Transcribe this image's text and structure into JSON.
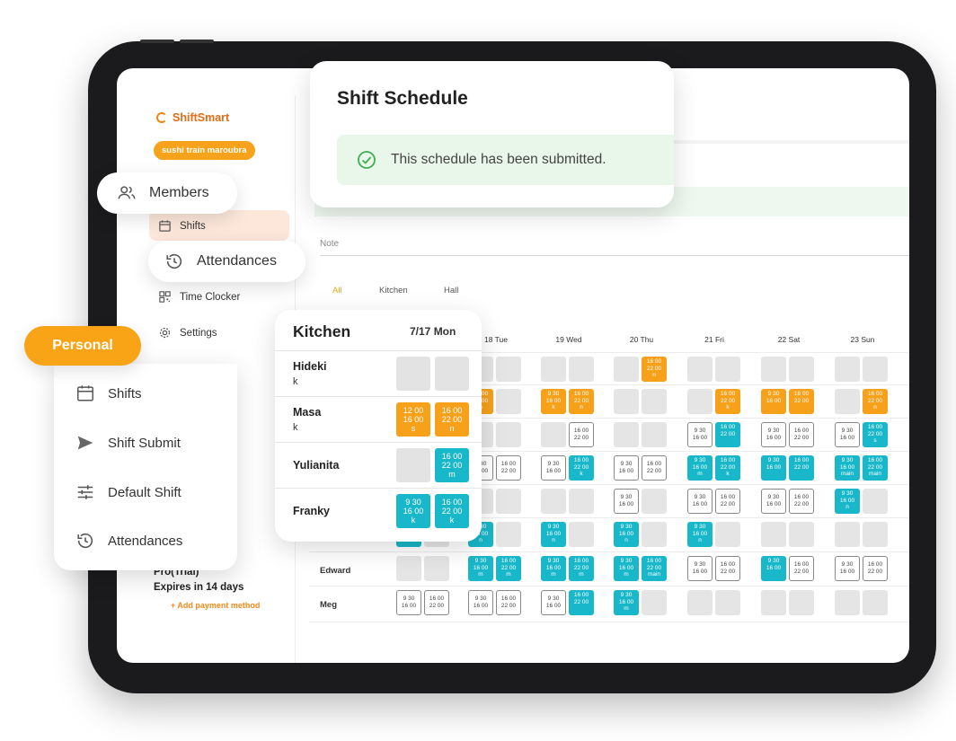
{
  "brand": {
    "name": "ShiftSmart",
    "store": "sushi train maroubra"
  },
  "sidebar": {
    "items": [
      {
        "label": "Shifts",
        "icon": "calendar-icon"
      },
      {
        "label": "Time Clocker",
        "icon": "qr-icon"
      },
      {
        "label": "Settings",
        "icon": "gear-icon"
      }
    ],
    "plan": {
      "name": "Pro(Trial)",
      "expires": "Expires in 14 days",
      "add_payment": "+ Add payment method"
    }
  },
  "pills": {
    "members": "Members",
    "attendances": "Attendances"
  },
  "schedule_card": {
    "title": "Shift Schedule",
    "submitted_msg": "This schedule has been submitted."
  },
  "note": {
    "label": "Note"
  },
  "filters": [
    "All",
    "Kitchen",
    "Hall"
  ],
  "days": [
    "18 Tue",
    "19 Wed",
    "20 Thu",
    "21 Fri",
    "22 Sat",
    "23 Sun"
  ],
  "employees": [
    "Edward",
    "Meg"
  ],
  "personal": {
    "label": "Personal",
    "menu": [
      {
        "label": "Shifts",
        "icon": "calendar-icon"
      },
      {
        "label": "Shift Submit",
        "icon": "send-icon"
      },
      {
        "label": "Default Shift",
        "icon": "sliders-icon"
      },
      {
        "label": "Attendances",
        "icon": "history-icon"
      }
    ]
  },
  "kitchen": {
    "title": "Kitchen",
    "date": "7/17 Mon",
    "rows": [
      {
        "name": "Hideki",
        "sub": "k",
        "cells": [
          {
            "type": "empty",
            "text": ""
          },
          {
            "type": "empty",
            "text": ""
          }
        ]
      },
      {
        "name": "Masa",
        "sub": "k",
        "cells": [
          {
            "type": "orange",
            "text": "12 00\n16 00\ns"
          },
          {
            "type": "orange",
            "text": "16 00\n22 00\nn"
          }
        ]
      },
      {
        "name": "Yulianita",
        "sub": "",
        "cells": [
          {
            "type": "empty",
            "text": ""
          },
          {
            "type": "teal",
            "text": "16 00\n22 00\nm"
          }
        ]
      },
      {
        "name": "Franky",
        "sub": "",
        "cells": [
          {
            "type": "teal",
            "text": "9 30\n16 00\nk"
          },
          {
            "type": "teal",
            "text": "16 00\n22 00\nk"
          }
        ]
      }
    ]
  },
  "grid": [
    [
      {
        "t": "x"
      },
      {
        "t": "x"
      },
      {
        "t": "x"
      },
      {
        "t": "x"
      },
      {
        "t": "x"
      },
      {
        "t": "o",
        "v": "16 00\n22 00\nn"
      },
      {
        "t": "x"
      },
      {
        "t": "x"
      },
      {
        "t": "x"
      },
      {
        "t": "x"
      },
      {
        "t": "x"
      },
      {
        "t": "x"
      }
    ],
    [
      {
        "t": "o",
        "v": "16 00\n22 00\nn"
      },
      {
        "t": "x"
      },
      {
        "t": "o",
        "v": "9 30\n16 00\nk"
      },
      {
        "t": "o",
        "v": "16 00\n22 00\nn"
      },
      {
        "t": "x"
      },
      {
        "t": "x"
      },
      {
        "t": "x"
      },
      {
        "t": "o",
        "v": "16 00\n22 00\nk"
      },
      {
        "t": "o",
        "v": "9 30\n16 00"
      },
      {
        "t": "o",
        "v": "16 00\n22 00"
      },
      {
        "t": "x"
      },
      {
        "t": "o",
        "v": "16 00\n22 00\nn"
      }
    ],
    [
      {
        "t": "x"
      },
      {
        "t": "x"
      },
      {
        "t": "x"
      },
      {
        "t": "w",
        "v": "16 00\n22 00"
      },
      {
        "t": "x"
      },
      {
        "t": "x"
      },
      {
        "t": "w",
        "v": "9 30\n16 00"
      },
      {
        "t": "c",
        "v": "16 00\n22 00"
      },
      {
        "t": "w",
        "v": "9 30\n16 00"
      },
      {
        "t": "w",
        "v": "16 00\n22 00"
      },
      {
        "t": "w",
        "v": "9 30\n16 00"
      },
      {
        "t": "c",
        "v": "16 00\n22 00\ns"
      }
    ],
    [
      {
        "t": "w",
        "v": "9 30\n16 00"
      },
      {
        "t": "w",
        "v": "16 00\n22 00"
      },
      {
        "t": "w",
        "v": "9 30\n16 00"
      },
      {
        "t": "c",
        "v": "16 00\n22 00\nk"
      },
      {
        "t": "w",
        "v": "9 30\n16 00"
      },
      {
        "t": "w",
        "v": "16 00\n22 00"
      },
      {
        "t": "c",
        "v": "9 30\n16 00\nm"
      },
      {
        "t": "c",
        "v": "16 00\n22 00\nk"
      },
      {
        "t": "c",
        "v": "9 30\n16 00"
      },
      {
        "t": "c",
        "v": "16 00\n22 00"
      },
      {
        "t": "c",
        "v": "9 30\n16 00\nmain"
      },
      {
        "t": "c",
        "v": "16 00\n22 00\nmain"
      }
    ],
    [
      {
        "t": "x"
      },
      {
        "t": "x"
      },
      {
        "t": "x"
      },
      {
        "t": "x"
      },
      {
        "t": "w",
        "v": "9 30\n16 00"
      },
      {
        "t": "x"
      },
      {
        "t": "w",
        "v": "9 30\n16 00"
      },
      {
        "t": "w",
        "v": "16 00\n22 00"
      },
      {
        "t": "w",
        "v": "9 30\n16 00"
      },
      {
        "t": "w",
        "v": "16 00\n22 00"
      },
      {
        "t": "c",
        "v": "9 30\n16 00\nn"
      },
      {
        "t": "x"
      }
    ],
    [
      {
        "t": "c",
        "v": "9 30\n16 00\nn"
      },
      {
        "t": "x"
      },
      {
        "t": "c",
        "v": "9 30\n16 00\nn"
      },
      {
        "t": "x"
      },
      {
        "t": "c",
        "v": "9 30\n16 00\nn"
      },
      {
        "t": "x"
      },
      {
        "t": "c",
        "v": "9 30\n16 00\nn"
      },
      {
        "t": "x"
      },
      {
        "t": "x"
      },
      {
        "t": "x"
      },
      {
        "t": "x"
      },
      {
        "t": "x"
      }
    ],
    [
      {
        "t": "c",
        "v": "9 30\n16 00\nm"
      },
      {
        "t": "c",
        "v": "16 00\n22 00\nm"
      },
      {
        "t": "c",
        "v": "9 30\n16 00\nm"
      },
      {
        "t": "c",
        "v": "16 00\n22 00\nm"
      },
      {
        "t": "c",
        "v": "9 30\n16 00\nm"
      },
      {
        "t": "c",
        "v": "16 00\n22 00\nmain"
      },
      {
        "t": "w",
        "v": "9 30\n16 00"
      },
      {
        "t": "w",
        "v": "16 00\n22 00"
      },
      {
        "t": "c",
        "v": "9 30\n16 00"
      },
      {
        "t": "w",
        "v": "16 00\n22 00"
      },
      {
        "t": "w",
        "v": "9 30\n16 00"
      },
      {
        "t": "w",
        "v": "16 00\n22 00"
      }
    ],
    [
      {
        "t": "w",
        "v": "9 30\n16 00"
      },
      {
        "t": "w",
        "v": "16 00\n22 00"
      },
      {
        "t": "w",
        "v": "9 30\n16 00"
      },
      {
        "t": "c",
        "v": "16 00\n22 00"
      },
      {
        "t": "c",
        "v": "9 30\n16 00\nm"
      },
      {
        "t": "x"
      },
      {
        "t": "x"
      },
      {
        "t": "x"
      },
      {
        "t": "x"
      },
      {
        "t": "x"
      },
      {
        "t": "x"
      },
      {
        "t": "x"
      }
    ]
  ],
  "grid_prefix": [
    [
      {
        "t": "x"
      },
      {
        "t": "x"
      }
    ],
    [
      {
        "t": "x"
      },
      {
        "t": "x"
      }
    ],
    [
      {
        "t": "x"
      },
      {
        "t": "x"
      }
    ],
    [
      {
        "t": "x"
      },
      {
        "t": "x"
      }
    ],
    [
      {
        "t": "x"
      },
      {
        "t": "x"
      }
    ],
    [
      {
        "t": "c",
        "v": "n"
      },
      {
        "t": "x"
      }
    ],
    [
      {
        "t": "x"
      },
      {
        "t": "x"
      }
    ],
    [
      {
        "t": "w",
        "v": "9 30\n16 00"
      },
      {
        "t": "w",
        "v": "16 00\n22 00"
      }
    ]
  ],
  "colors": {
    "orange": "#f7a11a",
    "teal": "#18b7c9",
    "brand": "#e66b12",
    "success_bg": "#e9f6ea",
    "success_icon": "#3fae52"
  }
}
